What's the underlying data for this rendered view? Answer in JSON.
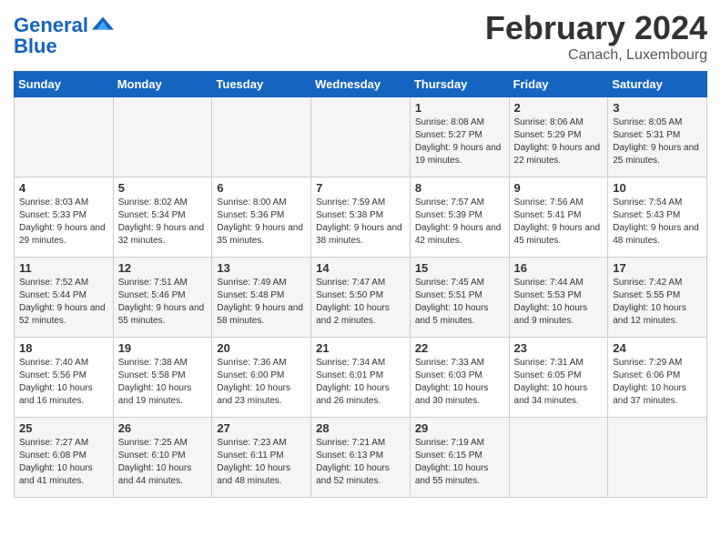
{
  "header": {
    "logo_line1": "General",
    "logo_line2": "Blue",
    "month_title": "February 2024",
    "location": "Canach, Luxembourg"
  },
  "days_of_week": [
    "Sunday",
    "Monday",
    "Tuesday",
    "Wednesday",
    "Thursday",
    "Friday",
    "Saturday"
  ],
  "weeks": [
    [
      {
        "num": "",
        "info": ""
      },
      {
        "num": "",
        "info": ""
      },
      {
        "num": "",
        "info": ""
      },
      {
        "num": "",
        "info": ""
      },
      {
        "num": "1",
        "info": "Sunrise: 8:08 AM\nSunset: 5:27 PM\nDaylight: 9 hours\nand 19 minutes."
      },
      {
        "num": "2",
        "info": "Sunrise: 8:06 AM\nSunset: 5:29 PM\nDaylight: 9 hours\nand 22 minutes."
      },
      {
        "num": "3",
        "info": "Sunrise: 8:05 AM\nSunset: 5:31 PM\nDaylight: 9 hours\nand 25 minutes."
      }
    ],
    [
      {
        "num": "4",
        "info": "Sunrise: 8:03 AM\nSunset: 5:33 PM\nDaylight: 9 hours\nand 29 minutes."
      },
      {
        "num": "5",
        "info": "Sunrise: 8:02 AM\nSunset: 5:34 PM\nDaylight: 9 hours\nand 32 minutes."
      },
      {
        "num": "6",
        "info": "Sunrise: 8:00 AM\nSunset: 5:36 PM\nDaylight: 9 hours\nand 35 minutes."
      },
      {
        "num": "7",
        "info": "Sunrise: 7:59 AM\nSunset: 5:38 PM\nDaylight: 9 hours\nand 38 minutes."
      },
      {
        "num": "8",
        "info": "Sunrise: 7:57 AM\nSunset: 5:39 PM\nDaylight: 9 hours\nand 42 minutes."
      },
      {
        "num": "9",
        "info": "Sunrise: 7:56 AM\nSunset: 5:41 PM\nDaylight: 9 hours\nand 45 minutes."
      },
      {
        "num": "10",
        "info": "Sunrise: 7:54 AM\nSunset: 5:43 PM\nDaylight: 9 hours\nand 48 minutes."
      }
    ],
    [
      {
        "num": "11",
        "info": "Sunrise: 7:52 AM\nSunset: 5:44 PM\nDaylight: 9 hours\nand 52 minutes."
      },
      {
        "num": "12",
        "info": "Sunrise: 7:51 AM\nSunset: 5:46 PM\nDaylight: 9 hours\nand 55 minutes."
      },
      {
        "num": "13",
        "info": "Sunrise: 7:49 AM\nSunset: 5:48 PM\nDaylight: 9 hours\nand 58 minutes."
      },
      {
        "num": "14",
        "info": "Sunrise: 7:47 AM\nSunset: 5:50 PM\nDaylight: 10 hours\nand 2 minutes."
      },
      {
        "num": "15",
        "info": "Sunrise: 7:45 AM\nSunset: 5:51 PM\nDaylight: 10 hours\nand 5 minutes."
      },
      {
        "num": "16",
        "info": "Sunrise: 7:44 AM\nSunset: 5:53 PM\nDaylight: 10 hours\nand 9 minutes."
      },
      {
        "num": "17",
        "info": "Sunrise: 7:42 AM\nSunset: 5:55 PM\nDaylight: 10 hours\nand 12 minutes."
      }
    ],
    [
      {
        "num": "18",
        "info": "Sunrise: 7:40 AM\nSunset: 5:56 PM\nDaylight: 10 hours\nand 16 minutes."
      },
      {
        "num": "19",
        "info": "Sunrise: 7:38 AM\nSunset: 5:58 PM\nDaylight: 10 hours\nand 19 minutes."
      },
      {
        "num": "20",
        "info": "Sunrise: 7:36 AM\nSunset: 6:00 PM\nDaylight: 10 hours\nand 23 minutes."
      },
      {
        "num": "21",
        "info": "Sunrise: 7:34 AM\nSunset: 6:01 PM\nDaylight: 10 hours\nand 26 minutes."
      },
      {
        "num": "22",
        "info": "Sunrise: 7:33 AM\nSunset: 6:03 PM\nDaylight: 10 hours\nand 30 minutes."
      },
      {
        "num": "23",
        "info": "Sunrise: 7:31 AM\nSunset: 6:05 PM\nDaylight: 10 hours\nand 34 minutes."
      },
      {
        "num": "24",
        "info": "Sunrise: 7:29 AM\nSunset: 6:06 PM\nDaylight: 10 hours\nand 37 minutes."
      }
    ],
    [
      {
        "num": "25",
        "info": "Sunrise: 7:27 AM\nSunset: 6:08 PM\nDaylight: 10 hours\nand 41 minutes."
      },
      {
        "num": "26",
        "info": "Sunrise: 7:25 AM\nSunset: 6:10 PM\nDaylight: 10 hours\nand 44 minutes."
      },
      {
        "num": "27",
        "info": "Sunrise: 7:23 AM\nSunset: 6:11 PM\nDaylight: 10 hours\nand 48 minutes."
      },
      {
        "num": "28",
        "info": "Sunrise: 7:21 AM\nSunset: 6:13 PM\nDaylight: 10 hours\nand 52 minutes."
      },
      {
        "num": "29",
        "info": "Sunrise: 7:19 AM\nSunset: 6:15 PM\nDaylight: 10 hours\nand 55 minutes."
      },
      {
        "num": "",
        "info": ""
      },
      {
        "num": "",
        "info": ""
      }
    ]
  ]
}
